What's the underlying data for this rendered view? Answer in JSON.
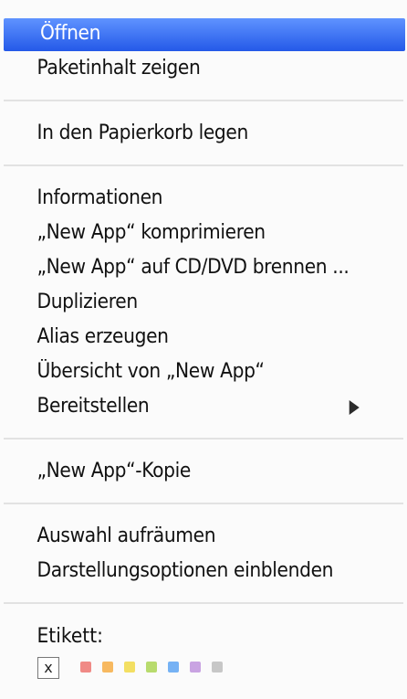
{
  "menu": {
    "groups": [
      {
        "items": [
          {
            "label": "Öffnen",
            "selected": true
          },
          {
            "label": "Paketinhalt zeigen"
          }
        ]
      },
      {
        "items": [
          {
            "label": "In den Papierkorb legen"
          }
        ]
      },
      {
        "items": [
          {
            "label": "Informationen"
          },
          {
            "label": "„New App“ komprimieren"
          },
          {
            "label": "„New App“ auf CD/DVD brennen ..."
          },
          {
            "label": "Duplizieren"
          },
          {
            "label": "Alias erzeugen"
          },
          {
            "label": "Übersicht von „New App“"
          },
          {
            "label": "Bereitstellen",
            "submenu": true
          }
        ]
      },
      {
        "items": [
          {
            "label": "„New App“-Kopie"
          }
        ]
      },
      {
        "items": [
          {
            "label": "Auswahl aufräumen"
          },
          {
            "label": "Darstellungsoptionen einblenden"
          }
        ]
      }
    ],
    "label_section": {
      "title": "Etikett:",
      "clear_symbol": "x",
      "colors": [
        {
          "name": "red",
          "hex": "#f08a86"
        },
        {
          "name": "orange",
          "hex": "#f7b960"
        },
        {
          "name": "yellow",
          "hex": "#f3df62"
        },
        {
          "name": "green",
          "hex": "#b8db6d"
        },
        {
          "name": "blue",
          "hex": "#76b2f4"
        },
        {
          "name": "purple",
          "hex": "#c9a3e2"
        },
        {
          "name": "gray",
          "hex": "#c7c7c7"
        }
      ]
    }
  }
}
